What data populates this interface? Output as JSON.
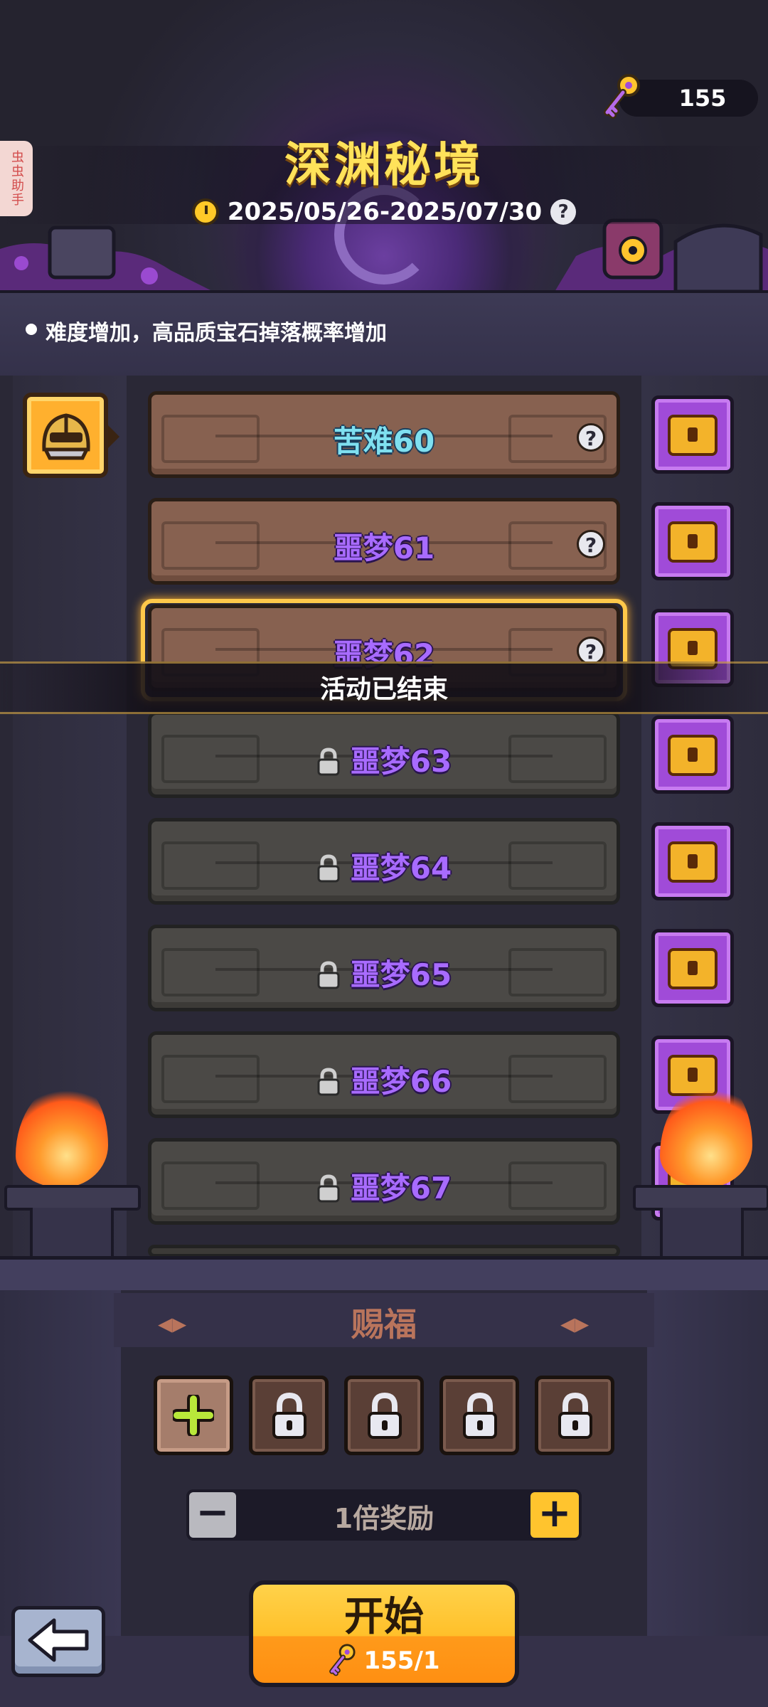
{
  "header": {
    "title": "深渊秘境",
    "date_range": "2025/05/26-2025/07/30",
    "help_glyph": "?",
    "currency_value": "155",
    "side_tab": "虫虫助手"
  },
  "notice": {
    "text": "难度增加，高品质宝石掉落概率增加"
  },
  "levels": [
    {
      "name": "苦难60",
      "locked": false,
      "help": "?"
    },
    {
      "name": "噩梦61",
      "locked": false,
      "help": "?"
    },
    {
      "name": "噩梦62",
      "locked": false,
      "help": "?"
    },
    {
      "name": "噩梦63",
      "locked": true
    },
    {
      "name": "噩梦64",
      "locked": true
    },
    {
      "name": "噩梦65",
      "locked": true
    },
    {
      "name": "噩梦66",
      "locked": true
    },
    {
      "name": "噩梦67",
      "locked": true
    }
  ],
  "ended_banner": "活动已结束",
  "blessing": {
    "title": "赐福",
    "slot_add_glyph": "+",
    "locked_slots": 4
  },
  "multiplier": {
    "label": "1倍奖励",
    "minus": "−",
    "plus": "+"
  },
  "start": {
    "label": "开始",
    "cost": "155/1"
  },
  "colors": {
    "title": "#ffe25a",
    "nightmare": "#a86bff",
    "hardship": "#7fe0f0",
    "start_button": "#ffc02a"
  }
}
